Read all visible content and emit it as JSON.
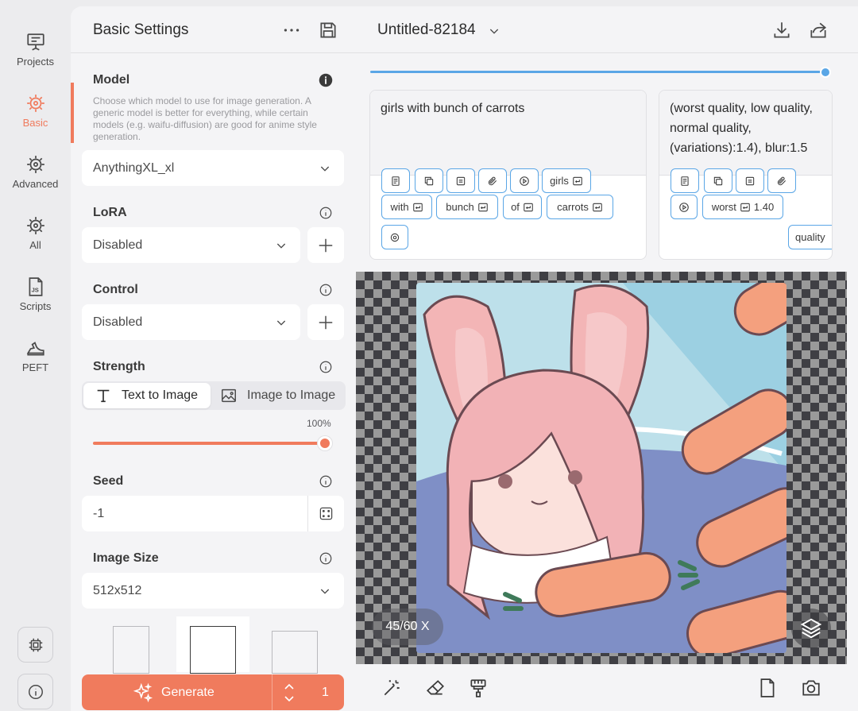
{
  "rail": {
    "items": [
      {
        "label": "Projects",
        "icon": "projects-icon"
      },
      {
        "label": "Basic",
        "icon": "basic-icon",
        "active": true
      },
      {
        "label": "Advanced",
        "icon": "advanced-icon"
      },
      {
        "label": "All",
        "icon": "all-icon"
      },
      {
        "label": "Scripts",
        "icon": "scripts-icon"
      },
      {
        "label": "PEFT",
        "icon": "peft-icon"
      }
    ]
  },
  "panel": {
    "title": "Basic Settings",
    "model": {
      "label": "Model",
      "description": "Choose which model to use for image generation. A generic model is better for everything, while certain models (e.g. waifu-diffusion) are good for anime style generation.",
      "value": "AnythingXL_xl"
    },
    "lora": {
      "label": "LoRA",
      "value": "Disabled"
    },
    "control": {
      "label": "Control",
      "value": "Disabled"
    },
    "strength": {
      "label": "Strength",
      "modes": [
        "Text to Image",
        "Image to Image"
      ],
      "selected_mode": "Text to Image",
      "value_text": "100%",
      "value": 1.0
    },
    "seed": {
      "label": "Seed",
      "value": "-1"
    },
    "image_size": {
      "label": "Image Size",
      "value": "512x512"
    },
    "generate": {
      "label": "Generate",
      "count": "1"
    }
  },
  "main": {
    "doc_title": "Untitled-82184",
    "prompt_progress": 1.0,
    "positive_prompt": {
      "text": "girls with bunch of carrots",
      "tokens": [
        "girls",
        "with",
        "bunch",
        "of",
        "carrots"
      ]
    },
    "negative_prompt": {
      "text": "(worst quality, low quality, normal quality, (variations):1.4), blur:1.5",
      "tokens": [
        "worst",
        "1.40",
        "quality"
      ]
    },
    "step_badge": "45/60 X"
  },
  "colors": {
    "accent": "#f07b5d",
    "blue": "#5aa6e6",
    "panel_bg": "#f4f4f6"
  }
}
